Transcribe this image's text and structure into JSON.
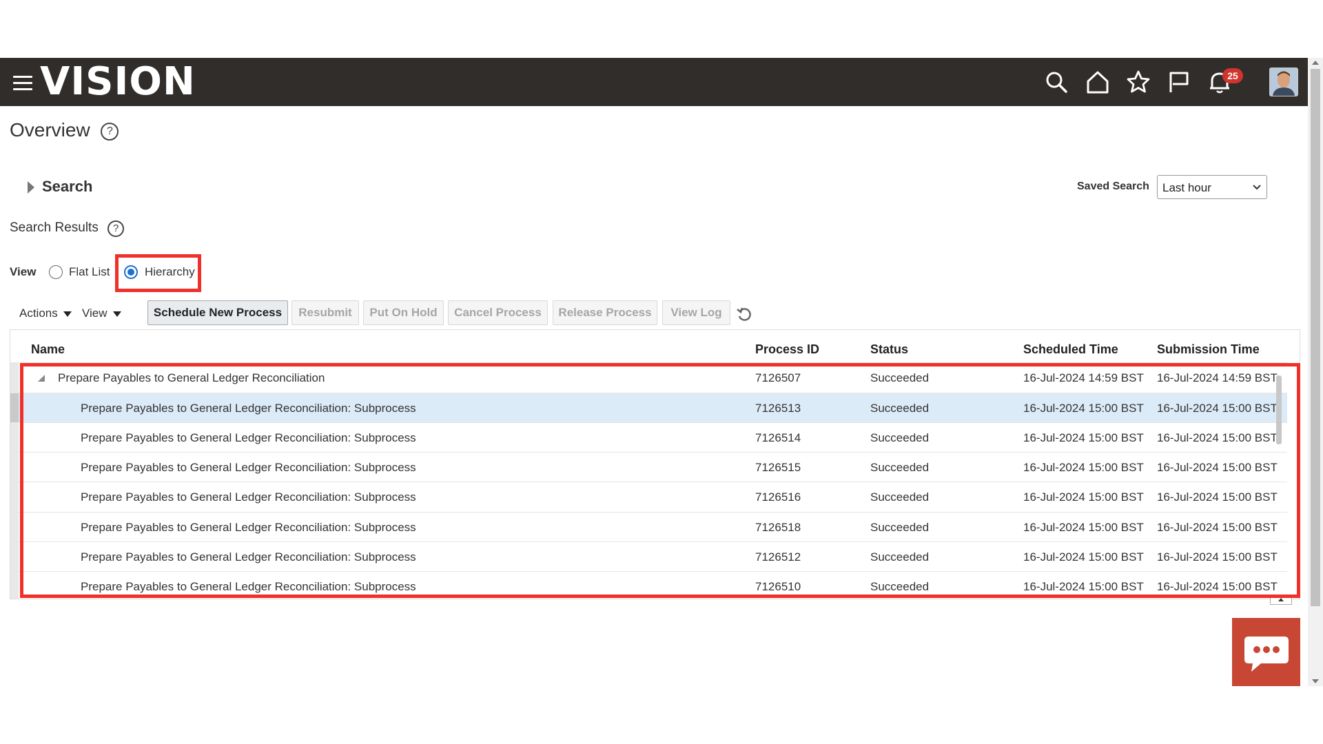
{
  "header": {
    "app_name": "VISION",
    "notification_count": "25",
    "icons": [
      "menu-icon",
      "search-icon",
      "home-icon",
      "star-icon",
      "flag-icon",
      "bell-icon"
    ]
  },
  "page": {
    "title": "Overview",
    "search_label": "Search",
    "saved_search_label": "Saved Search",
    "saved_search_value": "Last hour",
    "search_results_label": "Search Results",
    "view_label": "View",
    "view_options": [
      {
        "label": "Flat List",
        "selected": false
      },
      {
        "label": "Hierarchy",
        "selected": true
      }
    ]
  },
  "toolbar": {
    "actions_label": "Actions",
    "view_label": "View",
    "buttons": [
      "Schedule New Process",
      "Resubmit",
      "Put On Hold",
      "Cancel Process",
      "Release Process",
      "View Log"
    ]
  },
  "table": {
    "columns": [
      "Name",
      "Process ID",
      "Status",
      "Scheduled Time",
      "Submission Time"
    ],
    "rows": [
      {
        "name": "Prepare Payables to General Ledger Reconciliation",
        "id": "7126507",
        "status": "Succeeded",
        "scheduled": "16-Jul-2024 14:59 BST",
        "submitted": "16-Jul-2024 14:59 BST"
      },
      {
        "name": "Prepare Payables to General Ledger Reconciliation: Subprocess",
        "id": "7126513",
        "status": "Succeeded",
        "scheduled": "16-Jul-2024 15:00 BST",
        "submitted": "16-Jul-2024 15:00 BST"
      },
      {
        "name": "Prepare Payables to General Ledger Reconciliation: Subprocess",
        "id": "7126514",
        "status": "Succeeded",
        "scheduled": "16-Jul-2024 15:00 BST",
        "submitted": "16-Jul-2024 15:00 BST"
      },
      {
        "name": "Prepare Payables to General Ledger Reconciliation: Subprocess",
        "id": "7126515",
        "status": "Succeeded",
        "scheduled": "16-Jul-2024 15:00 BST",
        "submitted": "16-Jul-2024 15:00 BST"
      },
      {
        "name": "Prepare Payables to General Ledger Reconciliation: Subprocess",
        "id": "7126516",
        "status": "Succeeded",
        "scheduled": "16-Jul-2024 15:00 BST",
        "submitted": "16-Jul-2024 15:00 BST"
      },
      {
        "name": "Prepare Payables to General Ledger Reconciliation: Subprocess",
        "id": "7126518",
        "status": "Succeeded",
        "scheduled": "16-Jul-2024 15:00 BST",
        "submitted": "16-Jul-2024 15:00 BST"
      },
      {
        "name": "Prepare Payables to General Ledger Reconciliation: Subprocess",
        "id": "7126512",
        "status": "Succeeded",
        "scheduled": "16-Jul-2024 15:00 BST",
        "submitted": "16-Jul-2024 15:00 BST"
      },
      {
        "name": "Prepare Payables to General Ledger Reconciliation: Subprocess",
        "id": "7126510",
        "status": "Succeeded",
        "scheduled": "16-Jul-2024 15:00 BST",
        "submitted": "16-Jul-2024 15:00 BST"
      }
    ]
  },
  "colors": {
    "header_bg": "#312d2a",
    "highlight": "#f0302a",
    "selected_row": "#dcebf8",
    "chat_bg": "#c74634",
    "radio_accent": "#1d6fd0"
  }
}
